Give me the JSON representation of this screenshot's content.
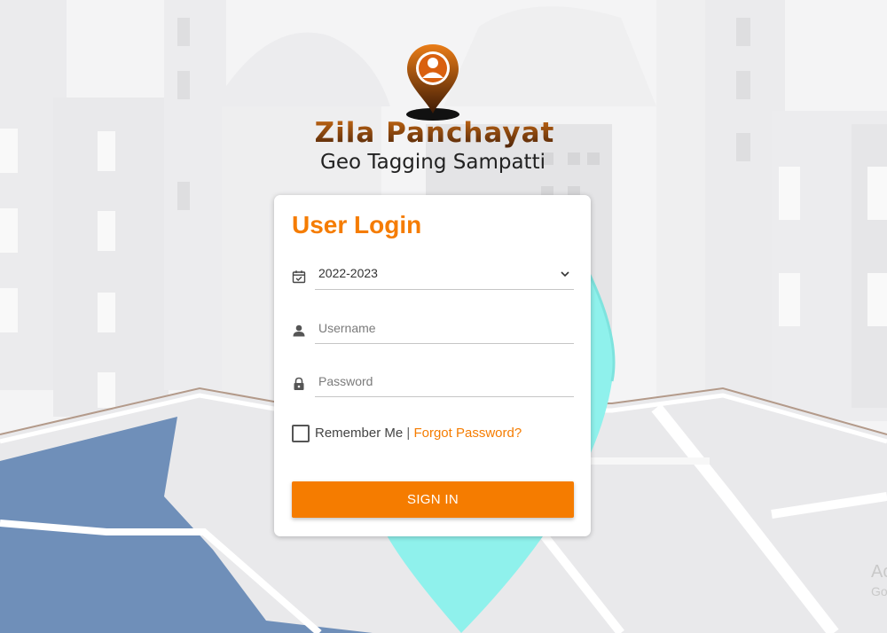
{
  "brand": {
    "title": "Zila Panchayat",
    "subtitle": "Geo Tagging Sampatti",
    "icon": "location-person-pin-icon"
  },
  "login": {
    "heading": "User Login",
    "year": {
      "value": "2022-2023",
      "icon": "calendar-check-icon"
    },
    "username": {
      "placeholder": "Username",
      "icon": "person-icon"
    },
    "password": {
      "placeholder": "Password",
      "icon": "lock-icon"
    },
    "remember_label": "Remember Me",
    "separator": "|",
    "forgot_label": "Forgot Password?",
    "signin_label": "SIGN IN"
  },
  "watermark": {
    "line1": "Ac",
    "line2": "Go"
  },
  "colors": {
    "accent": "#f57c00",
    "map_blue": "#6f8fb9",
    "pin_cyan": "#8ff1ec",
    "road_brown": "#b39a8a"
  }
}
